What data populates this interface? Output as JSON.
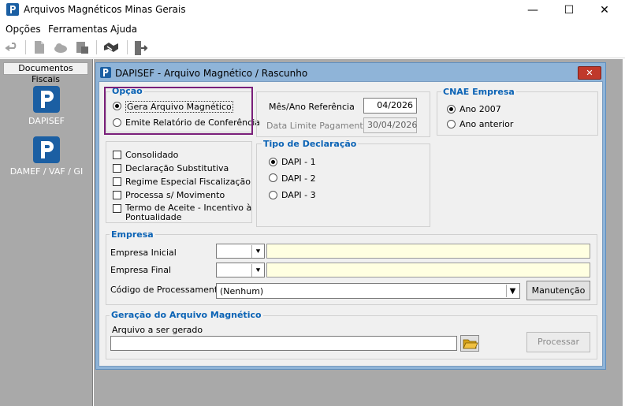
{
  "window": {
    "title": "Arquivos Magnéticos Minas Gerais",
    "minimize": "—",
    "maximize": "☐",
    "close": "✕"
  },
  "menu": [
    "Opções",
    "Ferramentas",
    "Ajuda"
  ],
  "toolbar": {
    "icons": [
      "undo-icon",
      "document-icon",
      "cloud-icon",
      "database-icon",
      "handshake-icon",
      "exit-door-icon"
    ]
  },
  "left_panel": {
    "header": "Documentos Fiscais",
    "items": [
      {
        "label": "DAPISEF",
        "icon": "dapisef-logo-icon"
      },
      {
        "label": "DAMEF / VAF / GI",
        "icon": "damef-logo-icon"
      }
    ]
  },
  "dialog": {
    "title": "DAPISEF - Arquivo Magnético / Rascunho",
    "close": "✕",
    "opcao": {
      "legend": "Opção",
      "options": [
        "Gera Arquivo Magnético",
        "Emite Relatório de Conferência"
      ],
      "selected": 0
    },
    "mes_ano": {
      "label": "Mês/Ano Referência",
      "value": "04/2026"
    },
    "data_limite": {
      "label": "Data Limite Pagamento",
      "value": "30/04/2026"
    },
    "cnae": {
      "legend": "CNAE Empresa",
      "options": [
        "Ano 2007",
        "Ano anterior"
      ],
      "selected": 0
    },
    "checkboxes": [
      "Consolidado",
      "Declaração Substitutiva",
      "Regime Especial Fiscalização",
      "Processa s/ Movimento",
      "Termo de Aceite - Incentivo à",
      "Pontualidade"
    ],
    "tipo": {
      "legend": "Tipo de Declaração",
      "options": [
        "DAPI - 1",
        "DAPI - 2",
        "DAPI - 3"
      ],
      "selected": 0
    },
    "empresa": {
      "legend": "Empresa",
      "inicial_label": "Empresa Inicial",
      "final_label": "Empresa Final",
      "codigo_label": "Código de Processamento",
      "codigo_value": "(Nenhum)",
      "manutencao": "Manutenção"
    },
    "geracao": {
      "legend": "Geração do Arquivo Magnético",
      "arquivo_label": "Arquivo a ser gerado",
      "processar": "Processar"
    }
  },
  "colors": {
    "accent_blue": "#0b63b5",
    "logo_blue": "#1b5fa3",
    "dialog_frame": "#8fb4d8",
    "highlight": "#7a1f7a",
    "close_red": "#c0392b"
  }
}
